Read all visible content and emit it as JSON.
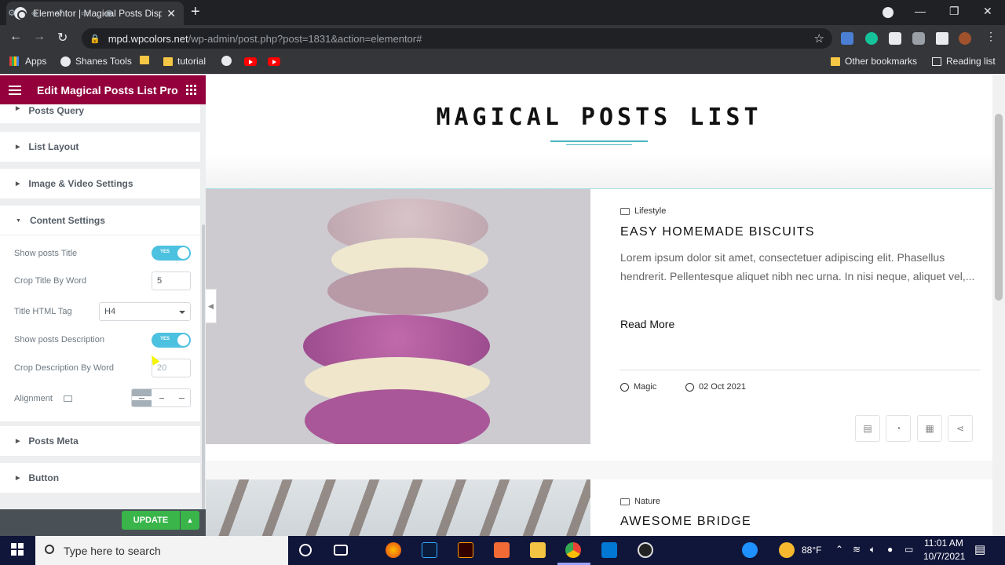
{
  "browser": {
    "tab_title": "Elementor | Magical Posts Displa",
    "url_host": "mpd.wpcolors.net",
    "url_path": "/wp-admin/post.php?post=1831&action=elementor#",
    "bookmarks": [
      "Apps",
      "Shanes Tools",
      "tutorial",
      "Other bookmarks",
      "Reading list"
    ]
  },
  "editor": {
    "header_title": "Edit Magical Posts List Pro",
    "sections": [
      "Posts Query",
      "List Layout",
      "Image & Video Settings",
      "Content Settings",
      "Posts Meta",
      "Button"
    ],
    "controls": {
      "show_title_label": "Show posts Title",
      "show_title_toggle": "YES",
      "crop_title_label": "Crop Title By Word",
      "crop_title_value": "5",
      "title_tag_label": "Title HTML Tag",
      "title_tag_value": "H4",
      "show_desc_label": "Show posts Description",
      "show_desc_toggle": "YES",
      "crop_desc_label": "Crop Description By Word",
      "crop_desc_value": "20",
      "alignment_label": "Alignment"
    },
    "update_label": "UPDATE"
  },
  "preview": {
    "main_title": "MAGICAL POSTS LIST",
    "posts": [
      {
        "category": "Lifestyle",
        "title": "EASY HOMEMADE BISCUITS",
        "description": "Lorem ipsum dolor sit amet, consectetuer adipiscing elit. Phasellus hendrerit. Pellentesque aliquet nibh nec urna. In nisi neque, aliquet vel,...",
        "read_more": "Read More",
        "author": "Magic",
        "date": "02 Oct 2021"
      },
      {
        "category": "Nature",
        "title": "AWESOME BRIDGE"
      }
    ]
  },
  "taskbar": {
    "search_placeholder": "Type here to search",
    "temperature": "88°F",
    "time": "11:01 AM",
    "date": "10/7/2021"
  }
}
